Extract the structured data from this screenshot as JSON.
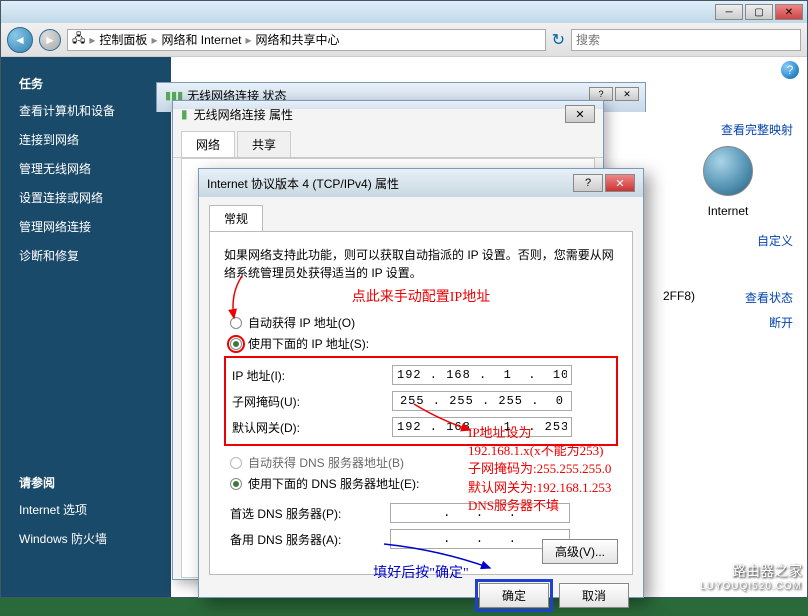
{
  "breadcrumb": {
    "p1": "控制面板",
    "p2": "网络和 Internet",
    "p3": "网络和共享中心"
  },
  "search": {
    "placeholder": "搜索"
  },
  "sidebar": {
    "heading1": "任务",
    "items": [
      "查看计算机和设备",
      "连接到网络",
      "管理无线网络",
      "设置连接或网络",
      "管理网络连接",
      "诊断和修复"
    ],
    "heading2": "请参阅",
    "items2": [
      "Internet 选项",
      "Windows 防火墙"
    ]
  },
  "mainright": {
    "viewmap": "查看完整映射",
    "internet": "Internet",
    "custom": "自定义",
    "net_id": "2FF8)",
    "viewstatus": "查看状态",
    "disconnect": "断开"
  },
  "status_window": {
    "title": "无线网络连接 状态"
  },
  "props_window": {
    "title": "无线网络连接 属性",
    "tab1": "网络",
    "tab2": "共享"
  },
  "ipv4": {
    "title": "Internet 协议版本 4 (TCP/IPv4) 属性",
    "tab": "常规",
    "desc": "如果网络支持此功能，则可以获取自动指派的 IP 设置。否则，您需要从网络系统管理员处获得适当的 IP 设置。",
    "annot_manual": "点此来手动配置IP地址",
    "radio_auto_ip": "自动获得 IP 地址(O)",
    "radio_manual_ip": "使用下面的 IP 地址(S):",
    "ip_label": "IP 地址(I):",
    "ip_value": "192 . 168 .  1  .  10",
    "mask_label": "子网掩码(U):",
    "mask_value": "255 . 255 . 255 .  0",
    "gw_label": "默认网关(D):",
    "gw_value": "192 . 168 .  1  . 253",
    "radio_auto_dns": "自动获得 DNS 服务器地址(B)",
    "radio_manual_dns": "使用下面的 DNS 服务器地址(E):",
    "dns1_label": "首选 DNS 服务器(P):",
    "dns2_label": "备用 DNS 服务器(A):",
    "annot_right": "IP地址设为\n192.168.1.x(x不能为253)\n子网掩码为:255.255.255.0\n默认网关为:192.168.1.253\nDNS服务器不填",
    "annot_ok": "填好后按\"确定\"",
    "advanced": "高级(V)...",
    "ok": "确定",
    "cancel": "取消"
  },
  "watermark": {
    "line1": "路由器之家",
    "line2": "LUYOUQI520.COM"
  }
}
